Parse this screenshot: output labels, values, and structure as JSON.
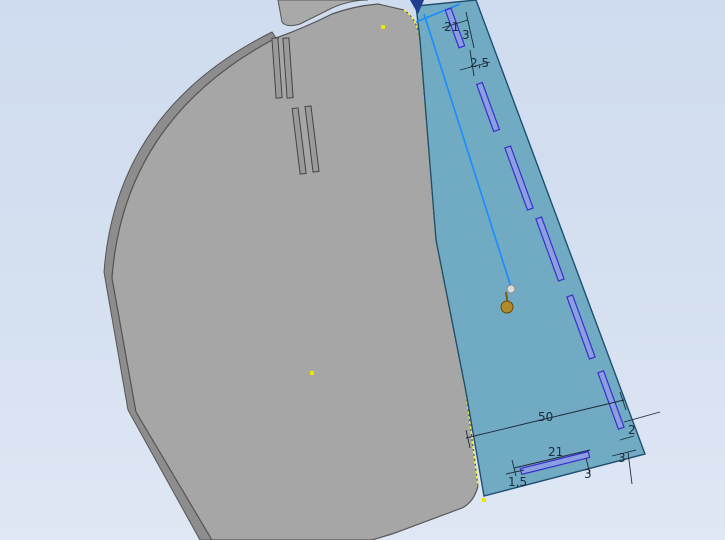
{
  "viewport": {
    "background_top": "#cfdcef",
    "background_bottom": "#dfe7f4"
  },
  "colors": {
    "part_face": "#a6a6a6",
    "part_edge": "#555555",
    "sketch_face": "#6aa7c0",
    "sketch_edge": "#1f4f72",
    "slot_outline": "#4a3fd1",
    "dimension_line": "#1e2b3a",
    "fold_line": "#f2ef3a",
    "construction_line": "#1a8cff",
    "point_marker": "#e8e800"
  },
  "part": {
    "slot_icon": "slot-icon",
    "vertex_icon": "vertex-point-icon"
  },
  "sketch": {
    "slot_count": 7,
    "grip_icon": "sketch-origin-grip-icon"
  },
  "dimensions": {
    "top_width": "21",
    "top_gap": "3",
    "top_offset": "2,5",
    "overall_length": "50",
    "bottom_slot_length": "21",
    "bottom_slot_offset": "1,5",
    "bottom_slot_width": "3",
    "right_edge_a": "2",
    "right_edge_b": "3"
  }
}
